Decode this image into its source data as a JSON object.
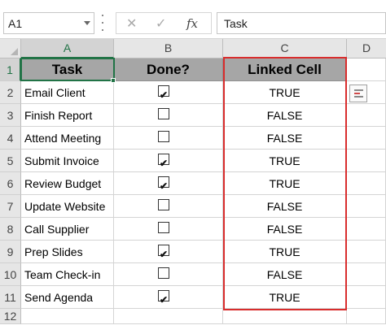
{
  "formula_bar": {
    "name_box": "A1",
    "cancel_glyph": "✕",
    "enter_glyph": "✓",
    "fx_label": "fx",
    "formula_value": "Task"
  },
  "columns": [
    "A",
    "B",
    "C",
    "D"
  ],
  "rows": [
    "1",
    "2",
    "3",
    "4",
    "5",
    "6",
    "7",
    "8",
    "9",
    "10",
    "11",
    "12"
  ],
  "headers": {
    "task": "Task",
    "done": "Done?",
    "linked": "Linked Cell"
  },
  "tasks": [
    {
      "task": "Email Client",
      "checked": true,
      "linked": "TRUE"
    },
    {
      "task": "Finish Report",
      "checked": false,
      "linked": "FALSE"
    },
    {
      "task": "Attend Meeting",
      "checked": false,
      "linked": "FALSE"
    },
    {
      "task": "Submit Invoice",
      "checked": true,
      "linked": "TRUE"
    },
    {
      "task": "Review Budget",
      "checked": true,
      "linked": "TRUE"
    },
    {
      "task": "Update Website",
      "checked": false,
      "linked": "FALSE"
    },
    {
      "task": "Call Supplier",
      "checked": false,
      "linked": "FALSE"
    },
    {
      "task": "Prep Slides",
      "checked": true,
      "linked": "TRUE"
    },
    {
      "task": "Team Check-in",
      "checked": false,
      "linked": "FALSE"
    },
    {
      "task": "Send Agenda",
      "checked": true,
      "linked": "TRUE"
    }
  ],
  "checkmark_glyph": "✔",
  "colors": {
    "header_fill": "#a6a6a6",
    "selection": "#217346",
    "highlight_border": "#d92d2d"
  },
  "icons": {
    "quick_analysis": "quick-analysis-icon"
  }
}
